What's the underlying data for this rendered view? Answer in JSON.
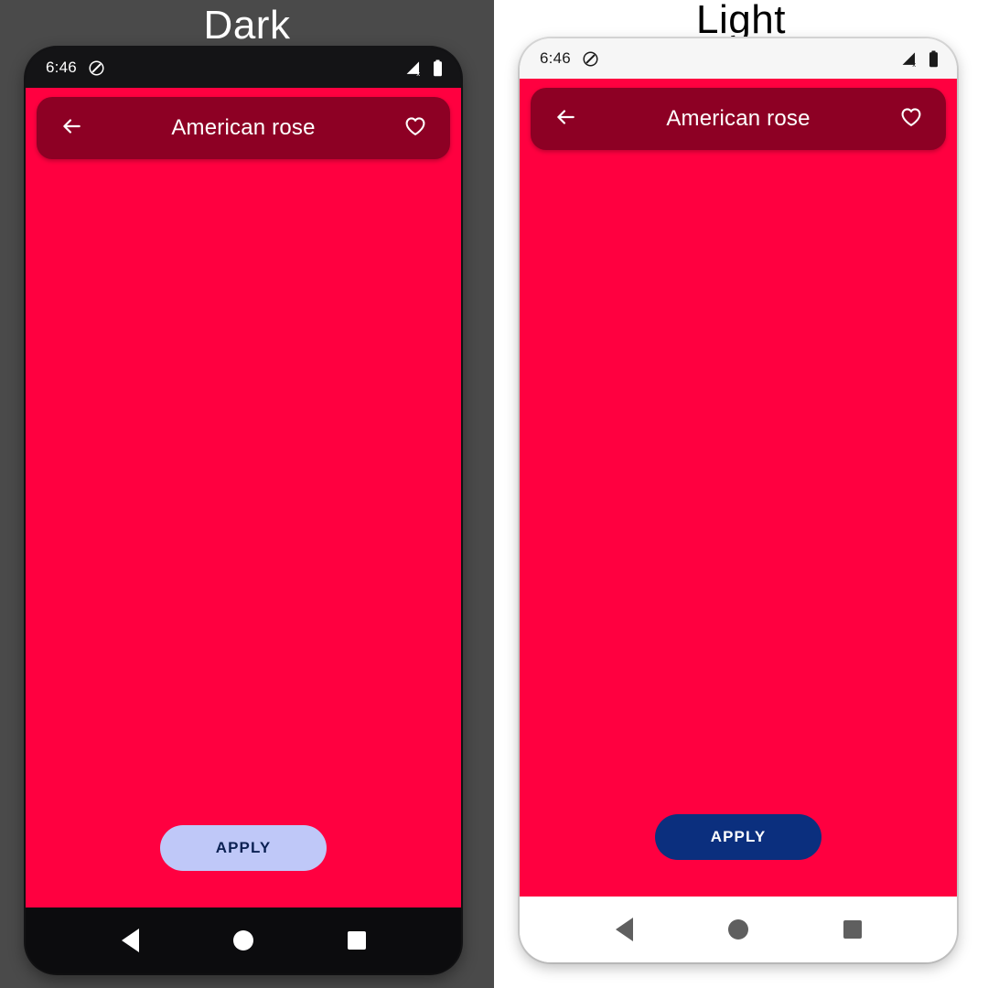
{
  "panels": [
    {
      "caption": "Dark",
      "theme": "dark",
      "statusbar": {
        "time": "6:46",
        "silent_icon": "do-not-disturb-icon",
        "signal_icon": "signal-no-service-icon",
        "battery_icon": "battery-full-icon"
      },
      "appbar": {
        "back_icon": "arrow-back-icon",
        "title": "American rose",
        "favorite_icon": "heart-outline-icon"
      },
      "apply_label": "APPLY",
      "navbar": {
        "back": "nav-back-triangle-icon",
        "home": "nav-home-circle-icon",
        "recents": "nav-recents-square-icon"
      },
      "colors": {
        "panel_background": "#4a4a4a",
        "caption_text": "#ffffff",
        "device_frame": "#0d0d0f",
        "statusbar_background": "#141416",
        "statusbar_text": "#ffffff",
        "screen_background": "#ff0040",
        "appbar_background": "#8d0024",
        "appbar_text": "#ffffff",
        "apply_background": "#bfc8f8",
        "apply_text": "#0b2153",
        "navbar_background": "#0c0c0e",
        "navbar_icon": "#ffffff"
      }
    },
    {
      "caption": "Light",
      "theme": "light",
      "statusbar": {
        "time": "6:46",
        "silent_icon": "do-not-disturb-icon",
        "signal_icon": "signal-no-service-icon",
        "battery_icon": "battery-full-icon"
      },
      "appbar": {
        "back_icon": "arrow-back-icon",
        "title": "American rose",
        "favorite_icon": "heart-outline-icon"
      },
      "apply_label": "APPLY",
      "navbar": {
        "back": "nav-back-triangle-icon",
        "home": "nav-home-circle-icon",
        "recents": "nav-recents-square-icon"
      },
      "colors": {
        "panel_background": "#ffffff",
        "caption_text": "#000000",
        "device_frame": "#fbfbfb",
        "statusbar_background": "#f6f6f6",
        "statusbar_text": "#1b1b1b",
        "screen_background": "#ff0040",
        "appbar_background": "#8d0024",
        "appbar_text": "#ffffff",
        "apply_background": "#0b2f7e",
        "apply_text": "#ffffff",
        "navbar_background": "#ffffff",
        "navbar_icon": "#5f5f5f"
      }
    }
  ]
}
